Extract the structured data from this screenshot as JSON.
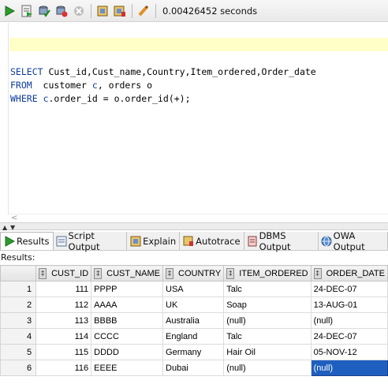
{
  "toolbar": {
    "icons": [
      "run-statement-icon",
      "run-script-icon",
      "commit-icon",
      "rollback-icon",
      "cancel-icon",
      "explain-plan-icon",
      "autotrace-icon",
      "clear-icon"
    ],
    "elapsed": "0.00426452 seconds"
  },
  "editor": {
    "line1": {
      "kw": "SELECT",
      "rest": " Cust_id,Cust_name,Country,Item_ordered,Order_date"
    },
    "line2": {
      "kw": "FROM",
      "rest1": "  customer ",
      "alias": "c",
      "rest2": ", orders o"
    },
    "line3": {
      "kw": "WHERE",
      "sp": " ",
      "alias": "c",
      "rest": ".order_id = o.order_id(+);"
    }
  },
  "tabs": [
    {
      "label": "Results",
      "icon": "run-green-icon"
    },
    {
      "label": "Script Output",
      "icon": "script-output-icon"
    },
    {
      "label": "Explain",
      "icon": "explain-icon"
    },
    {
      "label": "Autotrace",
      "icon": "autotrace-icon"
    },
    {
      "label": "DBMS Output",
      "icon": "dbms-output-icon"
    },
    {
      "label": "OWA Output",
      "icon": "owa-output-icon"
    }
  ],
  "results_label": "Results:",
  "grid": {
    "columns": [
      "CUST_ID",
      "CUST_NAME",
      "COUNTRY",
      "ITEM_ORDERED",
      "ORDER_DATE"
    ],
    "rows": [
      [
        "1",
        "111",
        "PPPP",
        "USA",
        "Talc",
        "24-DEC-07"
      ],
      [
        "2",
        "112",
        "AAAA",
        "UK",
        "Soap",
        "13-AUG-01"
      ],
      [
        "3",
        "113",
        "BBBB",
        "Australia",
        "(null)",
        "(null)"
      ],
      [
        "4",
        "114",
        "CCCC",
        "England",
        "Talc",
        "24-DEC-07"
      ],
      [
        "5",
        "115",
        "DDDD",
        "Germany",
        "Hair Oil",
        "05-NOV-12"
      ],
      [
        "6",
        "116",
        "EEEE",
        "Dubai",
        "(null)",
        "(null)"
      ]
    ],
    "selected_cell": {
      "row": 6,
      "column": "ORDER_DATE"
    }
  },
  "colors": {
    "keyword": "#0b3b9e",
    "current_line": "#ffffc8",
    "selection": "#1f5fbf"
  }
}
